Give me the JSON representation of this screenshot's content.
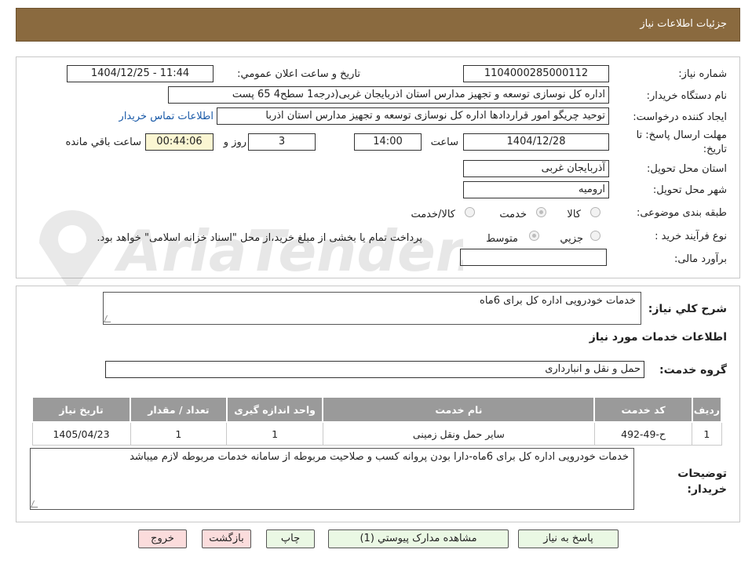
{
  "header": {
    "title": "جزئیات اطلاعات نیاز"
  },
  "form": {
    "need_number_label": "شماره نیاز:",
    "need_number": "1104000285000112",
    "announce_label": "تاریخ و ساعت اعلان عمومي:",
    "announce_value": "1404/12/25 - 11:44",
    "buyer_org_label": "نام دستگاه خریدار:",
    "buyer_org": "اداره کل نوسازی   توسعه و تجهیز مدارس استان اذربایجان غربی(درجه1  سطح4  65 پست",
    "creator_label": "ایجاد کننده درخواست:",
    "creator": "توحید چریگو امور قراردادها اداره کل نوسازی   توسعه و تجهیز مدارس استان اذربا",
    "contact_link": "اطلاعات تماس خریدار",
    "deadline_label": "مهلت ارسال پاسخ: تا تاریخ:",
    "deadline_date": "1404/12/28",
    "time_label": "ساعت",
    "deadline_time": "14:00",
    "days_value": "3",
    "days_label": "روز و",
    "remaining_time": "00:44:06",
    "remaining_label": "ساعت باقي مانده",
    "province_label": "استان محل تحویل:",
    "province": "آذربایجان غربی",
    "city_label": "شهر محل تحویل:",
    "city": "ارومیه",
    "category_label": "طبقه بندی موضوعی:",
    "category_options": [
      "کالا",
      "خدمت",
      "کالا/خدمت"
    ],
    "category_selected": "خدمت",
    "process_label": "نوع فرآیند خرید :",
    "process_options": [
      "جزیي",
      "متوسط"
    ],
    "process_selected": "متوسط",
    "process_note": "پرداخت تمام یا بخشی از مبلغ خرید،از محل \"اسناد خزانه اسلامی\" خواهد بود.",
    "budget_label": "برآورد مالی:",
    "budget": ""
  },
  "description": {
    "label": "شرح کلي نیاز:",
    "value": "خدمات خودرویی اداره کل برای 6ماه"
  },
  "services_section": {
    "title": "اطلاعات خدمات مورد نیاز",
    "group_label": "گروه خدمت:",
    "group_value": "حمل و نقل و انبارداری"
  },
  "table": {
    "headers": [
      "ردیف",
      "کد خدمت",
      "نام خدمت",
      "واحد اندازه گیری",
      "تعداد / مقدار",
      "تاریخ نیاز"
    ],
    "rows": [
      [
        "1",
        "ح-49-492",
        "سایر حمل ونقل زمینی",
        "1",
        "1",
        "1405/04/23"
      ]
    ]
  },
  "buyer_notes": {
    "label": "توضیحات خریدار:",
    "value": "خدمات خودرویی اداره کل برای 6ماه-دارا بودن پروانه کسب و صلاحیت مربوطه از سامانه خدمات مربوطه لازم میباشد"
  },
  "buttons": {
    "reply": "پاسخ به نیاز",
    "attachments": "مشاهده مدارک پیوستي (1)",
    "print": "چاپ",
    "back": "بازگشت",
    "exit": "خروج"
  },
  "watermark": {
    "text": "AriaTender.net"
  },
  "colors": {
    "header_bg": "#8a6a3f",
    "timer_bg": "#fbf6d2",
    "table_header_bg": "#9a9a9a",
    "link": "#1a5aa8"
  }
}
